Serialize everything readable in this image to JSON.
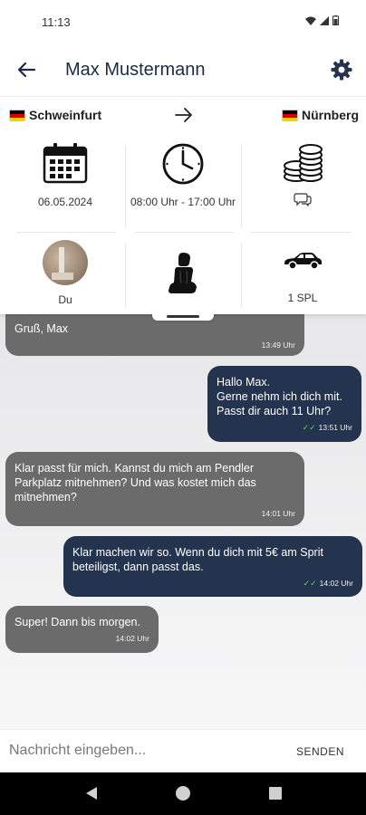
{
  "status": {
    "time": "11:13"
  },
  "header": {
    "title": "Max Mustermann"
  },
  "route": {
    "from": "Schweinfurt",
    "to": "Nürnberg"
  },
  "details": {
    "date": "06.05.2024",
    "time_range": "08:00 Uhr - 17:00 Uhr",
    "passenger_label": "Du",
    "seats_label": "1 SPL"
  },
  "messages": [
    {
      "direction": "in",
      "text": "Gruß, Max",
      "time": "13:49 Uhr"
    },
    {
      "direction": "out",
      "text": "Hallo Max.\nGerne nehm ich dich mit.\nPasst dir auch 11 Uhr?",
      "time": "13:51 Uhr"
    },
    {
      "direction": "in",
      "text": "Klar passt für mich. Kannst du mich am Pendler Parkplatz mitnehmen? Und was kostet mich das mitnehmen?",
      "time": "14:01 Uhr"
    },
    {
      "direction": "out",
      "text": "Klar machen wir so. Wenn du dich mit 5€ am Sprit beteiligst, dann passt das.",
      "time": "14:02 Uhr"
    },
    {
      "direction": "in",
      "text": "Super! Dann bis morgen.",
      "time": "14:02 Uhr"
    }
  ],
  "composer": {
    "placeholder": "Nachricht eingeben...",
    "send_label": "SENDEN"
  },
  "icons": [
    "arrow-back-icon",
    "gear-icon",
    "arrow-right-icon",
    "calendar-icon",
    "clock-icon",
    "coins-icon",
    "chat-icon",
    "car-seat-icon",
    "car-icon"
  ],
  "colors": {
    "outgoing": "#24344f",
    "incoming": "#6b6b6b",
    "title": "#1e2a44",
    "check": "#5fd35f"
  }
}
